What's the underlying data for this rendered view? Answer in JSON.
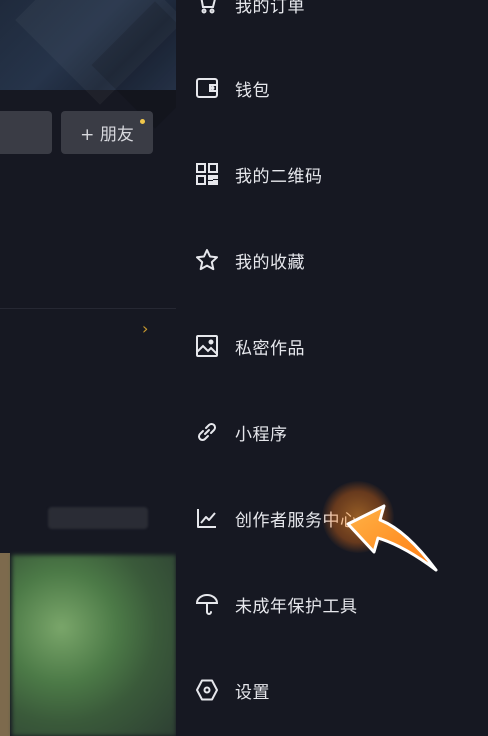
{
  "left_panel": {
    "add_friend_label": "+ 朋友",
    "chevron": "›"
  },
  "menu": {
    "items": [
      {
        "label": "我的订单",
        "icon": "cart-icon"
      },
      {
        "label": "钱包",
        "icon": "wallet-icon"
      },
      {
        "label": "我的二维码",
        "icon": "qr-code-icon"
      },
      {
        "label": "我的收藏",
        "icon": "star-icon"
      },
      {
        "label": "私密作品",
        "icon": "image-icon"
      },
      {
        "label": "小程序",
        "icon": "link-icon"
      },
      {
        "label": "创作者服务中心",
        "icon": "chart-icon"
      },
      {
        "label": "未成年保护工具",
        "icon": "umbrella-icon"
      },
      {
        "label": "设置",
        "icon": "settings-hexagon-icon"
      }
    ]
  },
  "colors": {
    "background": "#161822",
    "text": "#e6e7ec",
    "accent_dot": "#f2c84b",
    "pointer": "#ff8a1e"
  }
}
